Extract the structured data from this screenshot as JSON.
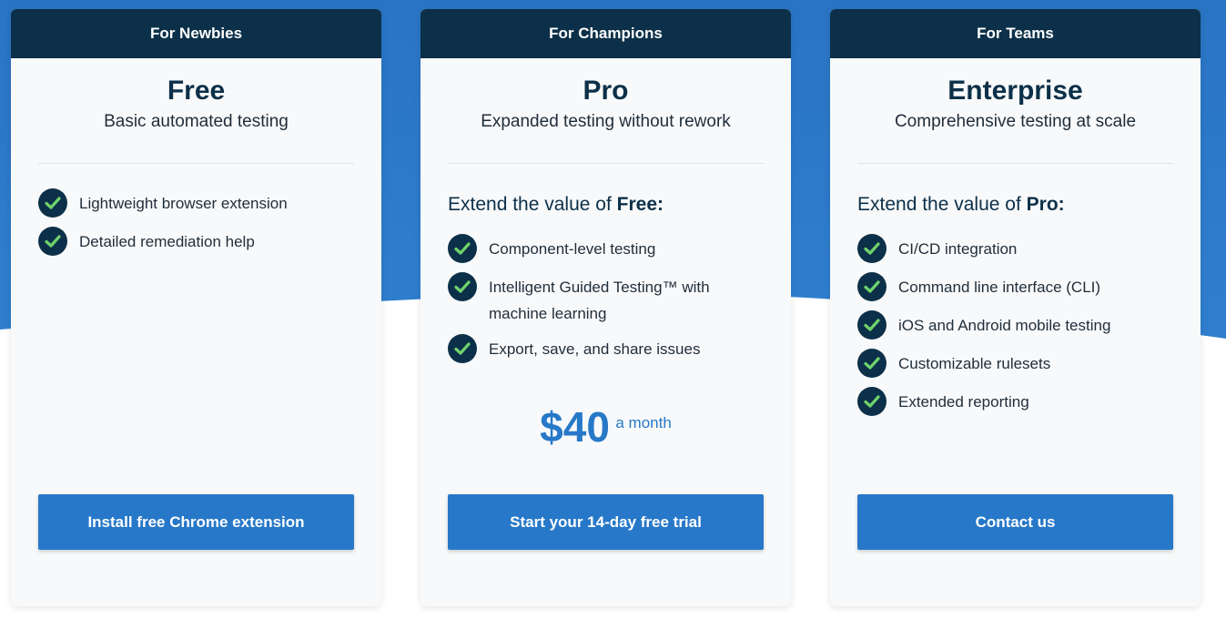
{
  "colors": {
    "header_bg": "#0c3049",
    "accent": "#2778c8",
    "check_green": "#6fd36b",
    "page_bg_top": "#2a74c4"
  },
  "plans": [
    {
      "audience": "For Newbies",
      "name": "Free",
      "tagline": "Basic automated testing",
      "features": [
        "Lightweight browser extension",
        "Detailed remediation help"
      ],
      "cta": "Install free Chrome extension"
    },
    {
      "audience": "For Champions",
      "name": "Pro",
      "tagline": "Expanded testing without rework",
      "extend_prefix": "Extend the value of ",
      "extend_plan": "Free:",
      "features": [
        "Component-level testing",
        "Intelligent Guided Testing™ with machine learning",
        "Export, save, and share issues"
      ],
      "price": "$40",
      "price_period": "a month",
      "cta": "Start your 14-day free trial"
    },
    {
      "audience": "For Teams",
      "name": "Enterprise",
      "tagline": "Comprehensive testing at scale",
      "extend_prefix": "Extend the value of ",
      "extend_plan": "Pro:",
      "features": [
        "CI/CD integration",
        "Command line interface (CLI)",
        "iOS and Android mobile testing",
        "Customizable rulesets",
        "Extended reporting"
      ],
      "cta": "Contact us"
    }
  ]
}
